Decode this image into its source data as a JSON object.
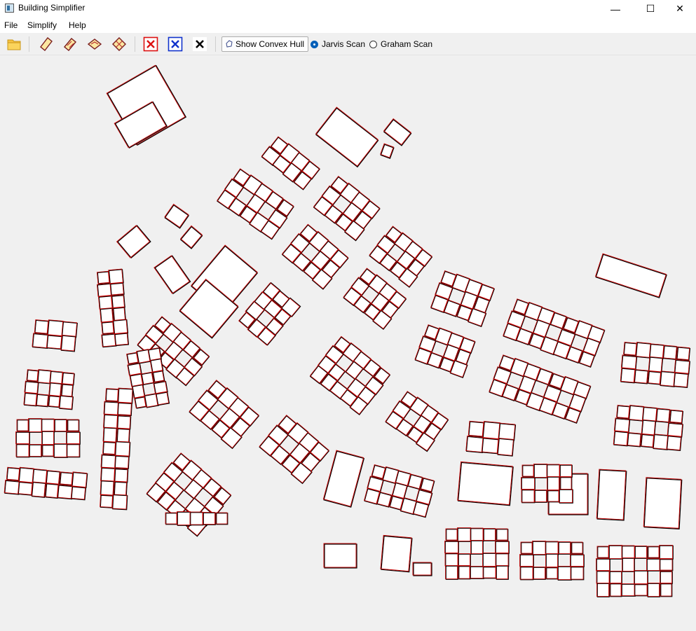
{
  "window": {
    "title": "Building Simplifier",
    "minimize": "—",
    "maximize": "☐",
    "close": "✕"
  },
  "menu": [
    "File",
    "Simplify",
    "Help"
  ],
  "toolbar": {
    "icons": [
      "open-folder-icon",
      "simplify-minimum-rectangle-icon",
      "simplify-wall-average-icon",
      "simplify-longest-edge-icon",
      "simplify-weighted-bisector-icon",
      "clear-red-icon",
      "clear-blue-icon",
      "clear-all-icon"
    ],
    "hull_button_label": "Show Convex Hull",
    "radio_options": [
      {
        "label": "Jarvis Scan",
        "selected": true
      },
      {
        "label": "Graham Scan",
        "selected": false
      }
    ]
  },
  "canvas": {
    "building_outline_color": "#000000",
    "simplified_color": "#cc0000",
    "fill": "#ffffff"
  }
}
